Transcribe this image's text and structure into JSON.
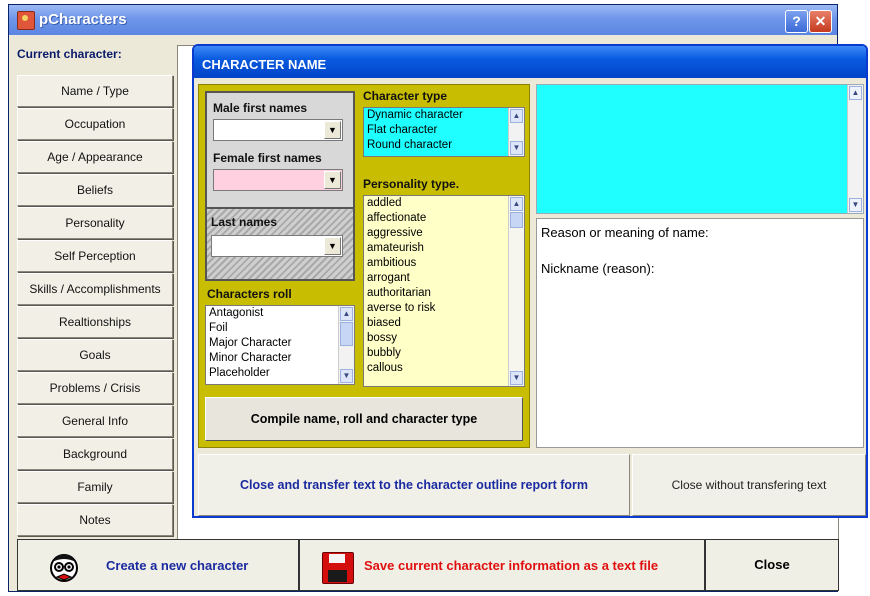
{
  "main_window": {
    "title": "pCharacters",
    "help_label": "?",
    "close_label": "✕",
    "current_character_label": "Current character:",
    "nav": [
      "Name / Type",
      "Occupation",
      "Age / Appearance",
      "Beliefs",
      "Personality",
      "Self Perception",
      "Skills / Accomplishments",
      "Realtionships",
      "Goals",
      "Problems / Crisis",
      "General Info",
      "Background",
      "Family",
      "Notes"
    ],
    "bottom": {
      "create_label": "Create a new character",
      "save_label": "Save current character information as a text file",
      "close_label": "Close"
    }
  },
  "dialog": {
    "title": "CHARACTER NAME",
    "male_first_names_label": "Male first names",
    "female_first_names_label": "Female first names",
    "last_names_label": "Last names",
    "male_first_names_value": "",
    "female_first_names_value": "",
    "last_names_value": "",
    "characters_roll_label": "Characters roll",
    "characters_roll": [
      "Antagonist",
      "Foil",
      "Major Character",
      "Minor Character",
      "Placeholder"
    ],
    "character_type_label": "Character type",
    "character_type": [
      "Dynamic character",
      "Flat character",
      "Round character"
    ],
    "personality_type_label": "Personality type.",
    "personality_type": [
      "addled",
      "affectionate",
      "aggressive",
      "amateurish",
      "ambitious",
      "arrogant",
      "authoritarian",
      "averse to risk",
      "biased",
      "bossy",
      "bubbly",
      "callous"
    ],
    "compile_label": "Compile name, roll and character type",
    "reason_label": "Reason or meaning of name:",
    "nickname_label": "Nickname (reason):",
    "transfer_label": "Close and transfer text to the character outline report form",
    "close_without_label": "Close without transfering text"
  },
  "colors": {
    "titlebar_blue": "#0a5be0",
    "olive": "#c8bd00",
    "cyan": "#1fffff",
    "light_yellow": "#ffffc8",
    "pink": "#ffd0e0"
  }
}
